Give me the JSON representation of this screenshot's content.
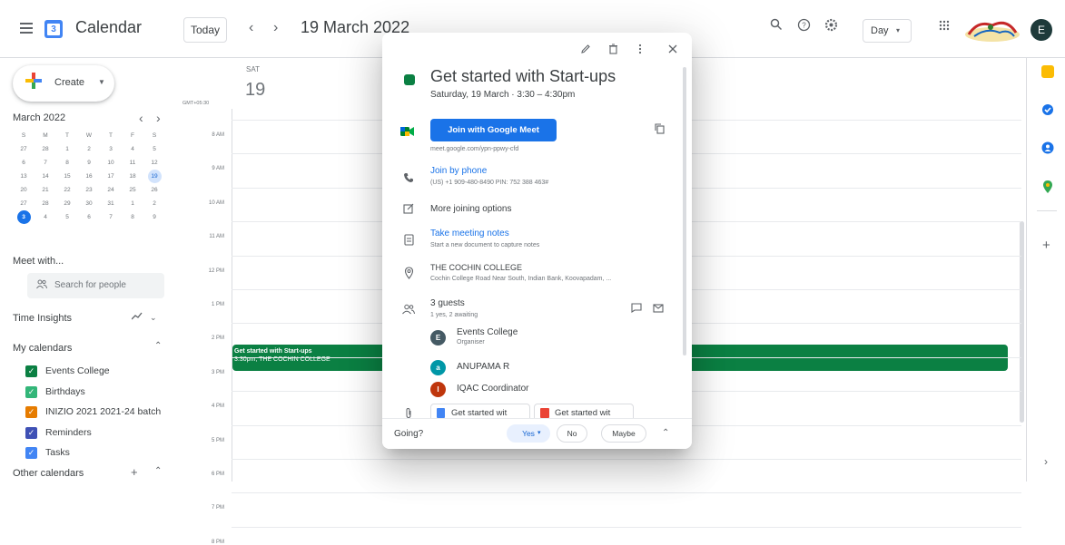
{
  "header": {
    "app_title": "Calendar",
    "logo_day": "3",
    "today_label": "Today",
    "prev_symbol": "‹",
    "next_symbol": "›",
    "date_title": "19 March 2022",
    "view_label": "Day",
    "view_caret": "▾",
    "avatar_letter": "E",
    "icons": [
      "menu-icon",
      "search-icon",
      "help-icon",
      "settings-icon",
      "apps-grid-icon"
    ]
  },
  "sidebar": {
    "create_label": "Create",
    "mini_cal": {
      "title": "March 2022",
      "days_of_week": [
        "S",
        "M",
        "T",
        "W",
        "T",
        "F",
        "S"
      ],
      "weeks": [
        [
          "27",
          "28",
          "1",
          "2",
          "3",
          "4",
          "5"
        ],
        [
          "6",
          "7",
          "8",
          "9",
          "10",
          "11",
          "12"
        ],
        [
          "13",
          "14",
          "15",
          "16",
          "17",
          "18",
          "19"
        ],
        [
          "20",
          "21",
          "22",
          "23",
          "24",
          "25",
          "26"
        ],
        [
          "27",
          "28",
          "29",
          "30",
          "31",
          "1",
          "2"
        ],
        [
          "3",
          "4",
          "5",
          "6",
          "7",
          "8",
          "9"
        ]
      ],
      "selected": "19",
      "today": "3"
    },
    "meet_with": "Meet with...",
    "search_people_placeholder": "Search for people",
    "time_insights": "Time Insights",
    "my_calendars": "My calendars",
    "calendars": [
      {
        "label": "Events College",
        "color": "#0b8043"
      },
      {
        "label": "Birthdays",
        "color": "#33b679"
      },
      {
        "label": "INIZIO 2021 2021-24 batch",
        "color": "#e67c00"
      },
      {
        "label": "Reminders",
        "color": "#3f51b5"
      },
      {
        "label": "Tasks",
        "color": "#4285f4"
      }
    ],
    "other_calendars": "Other calendars"
  },
  "main": {
    "day_abbr": "SAT",
    "day_number": "19",
    "timezone": "GMT+05:30",
    "hours": [
      "8 AM",
      "9 AM",
      "10 AM",
      "11 AM",
      "12 PM",
      "1 PM",
      "2 PM",
      "3 PM",
      "4 PM",
      "5 PM",
      "6 PM",
      "7 PM",
      "8 PM"
    ],
    "event": {
      "title": "Get started with Start-ups",
      "subtitle": "3:30pm, THE COCHIN COLLEGE",
      "color": "#0b8043"
    }
  },
  "popup": {
    "title": "Get started with Start-ups",
    "when": "Saturday, 19 March  ·  3:30 – 4:30pm",
    "meet_button": "Join with Google Meet",
    "meet_link": "meet.google.com/ypn-ppwy-cfd",
    "join_phone": "Join by phone",
    "phone_detail": "(US) +1 909-480-8490 PIN: 752 388 463#",
    "more_options": "More joining options",
    "take_notes": "Take meeting notes",
    "notes_detail": "Start a new document to capture notes",
    "location_name": "THE COCHIN COLLEGE",
    "location_address": "Cochin College Road Near South, Indian Bank, Koovapadam, ...",
    "guests_count": "3 guests",
    "guests_status": "1 yes, 2 awaiting",
    "guests": [
      {
        "name": "Events College",
        "role": "Organiser",
        "initial": "E",
        "color": "#455a64"
      },
      {
        "name": "ANUPAMA R",
        "role": "",
        "initial": "a",
        "color": "#0097a7"
      },
      {
        "name": "IQAC Coordinator",
        "role": "",
        "initial": "I",
        "color": "#bf360c"
      }
    ],
    "attachments": [
      "Get started wit",
      "Get started wit"
    ],
    "going_label": "Going?",
    "rsvp": {
      "yes": "Yes",
      "no": "No",
      "maybe": "Maybe"
    }
  }
}
